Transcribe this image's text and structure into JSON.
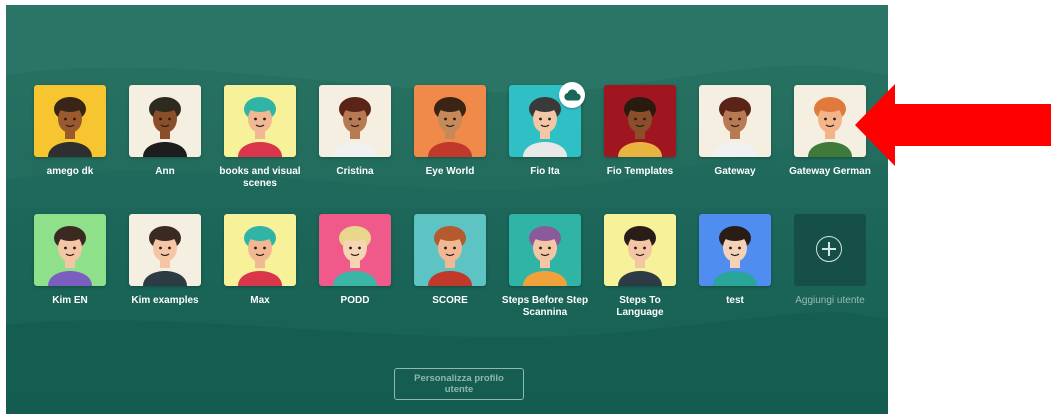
{
  "users_row1": [
    {
      "name": "amego dk",
      "bg": "#f7c530",
      "skin": "#9a5a2e",
      "hair": "#3a2415",
      "shirt": "#2f2f2f"
    },
    {
      "name": "Ann",
      "bg": "#f4efe0",
      "skin": "#8a4f2a",
      "hair": "#2d2a1e",
      "shirt": "#1d1d1d"
    },
    {
      "name": "books and visual scenes",
      "bg": "#f7f19a",
      "skin": "#f2b894",
      "hair": "#2fb4a6",
      "shirt": "#d9354b"
    },
    {
      "name": "Cristina",
      "bg": "#f4efe0",
      "skin": "#b87a52",
      "hair": "#5a2418",
      "shirt": "#f1f1f1"
    },
    {
      "name": "Eye World",
      "bg": "#ef8a4a",
      "skin": "#c68958",
      "hair": "#3b2413",
      "shirt": "#c0392b"
    },
    {
      "name": "Fio Ita",
      "bg": "#2fc0c6",
      "skin": "#f3c6a5",
      "hair": "#3a3a3a",
      "shirt": "#e8e8e8"
    },
    {
      "name": "Fio Templates",
      "bg": "#a01620",
      "skin": "#8a4f2a",
      "hair": "#2a1a10",
      "shirt": "#e8b341"
    },
    {
      "name": "Gateway",
      "bg": "#f4efe0",
      "skin": "#b87a52",
      "hair": "#5a2418",
      "shirt": "#f1f1f1"
    },
    {
      "name": "Gateway German",
      "bg": "#f4efe0",
      "skin": "#f4b48a",
      "hair": "#e07a3c",
      "shirt": "#3f7a3a"
    }
  ],
  "users_row2": [
    {
      "name": "Kim EN",
      "bg": "#8fe08a",
      "skin": "#f4c6a6",
      "hair": "#3a2a22",
      "shirt": "#7a5fc0"
    },
    {
      "name": "Kim examples",
      "bg": "#f4efe0",
      "skin": "#f4c6a6",
      "hair": "#3a2a22",
      "shirt": "#2d3b45"
    },
    {
      "name": "Max",
      "bg": "#f7f19a",
      "skin": "#f2b894",
      "hair": "#2fb4a6",
      "shirt": "#d9354b"
    },
    {
      "name": "PODD",
      "bg": "#f05a8a",
      "skin": "#f6d5b5",
      "hair": "#e8d68a",
      "shirt": "#3bb6a6"
    },
    {
      "name": "SCORE",
      "bg": "#5ec3c3",
      "skin": "#f2b894",
      "hair": "#b45a2e",
      "shirt": "#c0392b"
    },
    {
      "name": "Steps Before Step Scannina",
      "bg": "#2fb4a6",
      "skin": "#f4c6a6",
      "hair": "#8a5a9a",
      "shirt": "#f0a23a"
    },
    {
      "name": "Steps To Language",
      "bg": "#f7f19a",
      "skin": "#f4c6a6",
      "hair": "#2a1d18",
      "shirt": "#2d3b45"
    },
    {
      "name": "test",
      "bg": "#4f8ef0",
      "skin": "#f4d2b8",
      "hair": "#2a1d18",
      "shirt": "#2aa59a"
    }
  ],
  "add_user": {
    "label": "Aggiungi utente"
  },
  "customize_button": {
    "label": "Personalizza profilo utente"
  },
  "colors": {
    "panel": "#1b6659",
    "arrow": "#ff0000",
    "add_tile": "#164f47"
  }
}
